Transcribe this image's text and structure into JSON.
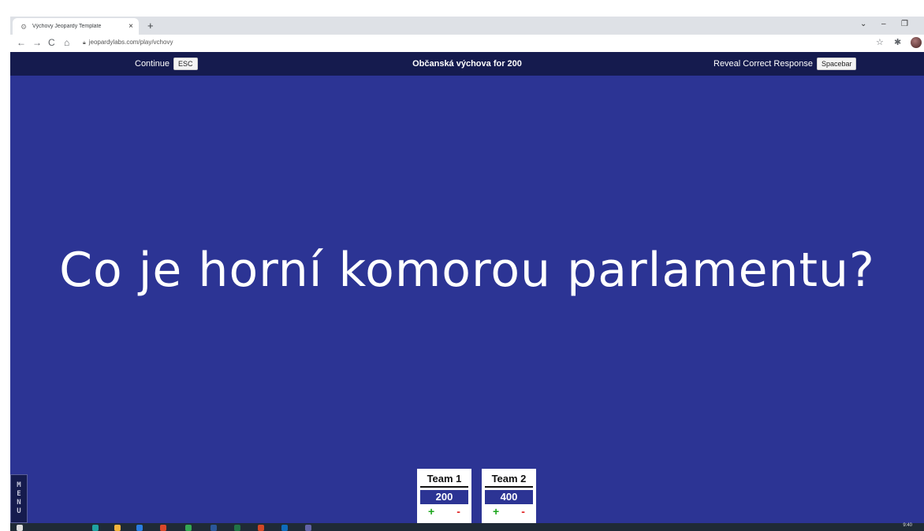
{
  "browser": {
    "tab_title": "Výchovy Jeopardy Template",
    "tab_close": "×",
    "new_tab": "+",
    "url": "jeopardylabs.com/play/vchovy",
    "nav": {
      "back": "←",
      "forward": "→",
      "reload": "C",
      "home": "⌂"
    },
    "window": {
      "dropdown": "⌄",
      "minimize": "–",
      "restore": "❐"
    },
    "toolbar": {
      "bookmark": "☆",
      "extensions": "✱"
    }
  },
  "topbar": {
    "continue_label": "Continue",
    "continue_key": "ESC",
    "question_title": "Občanská výchova for 200",
    "reveal_label": "Reveal Correct Response",
    "reveal_key": "Spacebar"
  },
  "question": "Co je horní komorou parlamentu?",
  "menu_letters": [
    "M",
    "E",
    "N",
    "U"
  ],
  "teams": [
    {
      "name": "Team 1",
      "score": "200",
      "plus": "+",
      "minus": "-"
    },
    {
      "name": "Team 2",
      "score": "400",
      "plus": "+",
      "minus": "-"
    }
  ],
  "taskbar": {
    "clock": "9:40"
  },
  "colors": {
    "page_bg": "#2c3494",
    "topbar_bg": "#151b4e",
    "plus": "#1aa51a",
    "minus": "#e02020"
  }
}
